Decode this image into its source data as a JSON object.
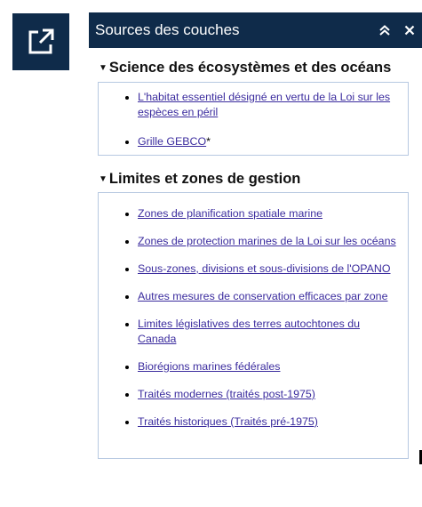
{
  "open_button": {
    "icon": "external-link-icon"
  },
  "panel": {
    "title": "Sources des couches",
    "collapse_icon": "double-chevron-up-icon",
    "close_icon": "close-icon"
  },
  "sections": [
    {
      "title": "Science des écosystèmes et des océans",
      "items": [
        {
          "link": "L'habitat essentiel désigné en vertu de la Loi sur les espèces en péril",
          "suffix": ""
        },
        {
          "link": "Grille GEBCO",
          "suffix": "*"
        }
      ]
    },
    {
      "title": "Limites et zones de gestion",
      "items": [
        {
          "link": "Zones de planification spatiale marine",
          "suffix": ""
        },
        {
          "link": "Zones de protection marines de la Loi sur les océans",
          "suffix": ""
        },
        {
          "link": "Sous-zones, divisions et sous-divisions de l'OPANO",
          "suffix": ""
        },
        {
          "link": "Autres mesures de conservation efficaces par zone",
          "suffix": ""
        },
        {
          "link": "Limites législatives des terres autochtones du Canada",
          "suffix": ""
        },
        {
          "link": "Biorégions marines fédérales",
          "suffix": ""
        },
        {
          "link": "Traités modernes (traités post-1975)",
          "suffix": ""
        },
        {
          "link": "Traités historiques (Traités pré-1975)",
          "suffix": ""
        }
      ]
    }
  ]
}
